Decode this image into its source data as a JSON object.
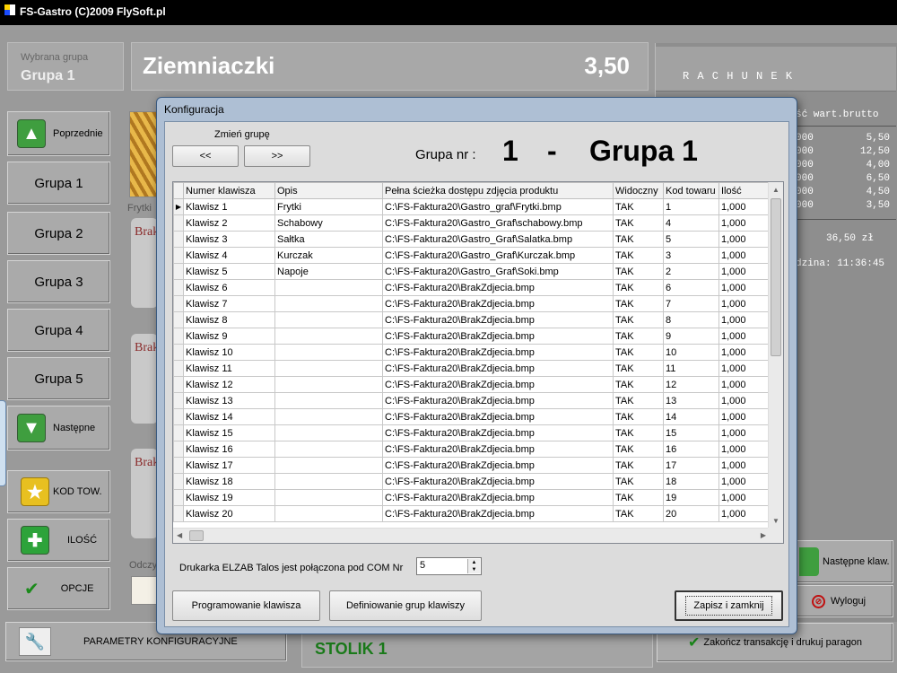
{
  "app": {
    "title": "FS-Gastro     (C)2009 FlySoft.pl"
  },
  "group_panel": {
    "label": "Wybrana grupa",
    "value": "Grupa 1"
  },
  "product_header": {
    "name": "Ziemniaczki",
    "price": "3,50"
  },
  "left_nav": {
    "prev_label": "Poprzednie",
    "groups": [
      "Grupa 1",
      "Grupa 2",
      "Grupa 3",
      "Grupa 4",
      "Grupa 5"
    ],
    "next_label": "Następne",
    "kod_label": "KOD TOW.",
    "ilosc_label": "ILOŚĆ",
    "opcje_label": "OPCJE",
    "params_label": "PARAMETRY  KONFIGURACYJNE"
  },
  "product_tiles": {
    "first_label": "Frytki",
    "placeholder_text": "Brak",
    "odczyt_label": "Odczy"
  },
  "table_label": "STOLIK 1",
  "receipt": {
    "heading": "R A C H U N E K",
    "col_header": "ść  wart.brutto",
    "rows": [
      {
        "qty": "000",
        "val": "5,50"
      },
      {
        "qty": "000",
        "val": "12,50"
      },
      {
        "qty": "000",
        "val": "4,00"
      },
      {
        "qty": "000",
        "val": "6,50"
      },
      {
        "qty": "000",
        "val": "4,50"
      },
      {
        "qty": "000",
        "val": "3,50"
      }
    ],
    "total": "36,50 zł",
    "time": "dzina: 11:36:45"
  },
  "right_buttons": {
    "next_keys": "Następne klaw.",
    "logout": "Wyloguj",
    "finish": "Zakończ transakcję i drukuj paragon"
  },
  "dialog": {
    "title": "Konfiguracja",
    "change_group_label": "Zmień grupę",
    "prev_btn": "<<",
    "next_btn": ">>",
    "group_nr_label": "Grupa nr :",
    "group_number": "1",
    "group_sep": "-",
    "group_name": "Grupa 1",
    "columns": [
      "Numer klawisza",
      "Opis",
      "Pełna ścieżka dostępu zdjęcia produktu",
      "Widoczny",
      "Kod towaru",
      "Ilość"
    ],
    "rows": [
      [
        "Klawisz 1",
        "Frytki",
        "C:\\FS-Faktura20\\Gastro_graf\\Frytki.bmp",
        "TAK",
        "1",
        "1,000"
      ],
      [
        "Klawisz 2",
        "Schabowy",
        "C:\\FS-Faktura20\\Gastro_Graf\\schabowy.bmp",
        "TAK",
        "4",
        "1,000"
      ],
      [
        "Klawisz 3",
        "Sałtka",
        "C:\\FS-Faktura20\\Gastro_Graf\\Salatka.bmp",
        "TAK",
        "5",
        "1,000"
      ],
      [
        "Klawisz 4",
        "Kurczak",
        "C:\\FS-Faktura20\\Gastro_Graf\\Kurczak.bmp",
        "TAK",
        "3",
        "1,000"
      ],
      [
        "Klawisz 5",
        "Napoje",
        "C:\\FS-Faktura20\\Gastro_Graf\\Soki.bmp",
        "TAK",
        "2",
        "1,000"
      ],
      [
        "Klawisz 6",
        "",
        "C:\\FS-Faktura20\\BrakZdjecia.bmp",
        "TAK",
        "6",
        "1,000"
      ],
      [
        "Klawisz 7",
        "",
        "C:\\FS-Faktura20\\BrakZdjecia.bmp",
        "TAK",
        "7",
        "1,000"
      ],
      [
        "Klawisz 8",
        "",
        "C:\\FS-Faktura20\\BrakZdjecia.bmp",
        "TAK",
        "8",
        "1,000"
      ],
      [
        "Klawisz 9",
        "",
        "C:\\FS-Faktura20\\BrakZdjecia.bmp",
        "TAK",
        "9",
        "1,000"
      ],
      [
        "Klawisz 10",
        "",
        "C:\\FS-Faktura20\\BrakZdjecia.bmp",
        "TAK",
        "10",
        "1,000"
      ],
      [
        "Klawisz 11",
        "",
        "C:\\FS-Faktura20\\BrakZdjecia.bmp",
        "TAK",
        "11",
        "1,000"
      ],
      [
        "Klawisz 12",
        "",
        "C:\\FS-Faktura20\\BrakZdjecia.bmp",
        "TAK",
        "12",
        "1,000"
      ],
      [
        "Klawisz 13",
        "",
        "C:\\FS-Faktura20\\BrakZdjecia.bmp",
        "TAK",
        "13",
        "1,000"
      ],
      [
        "Klawisz 14",
        "",
        "C:\\FS-Faktura20\\BrakZdjecia.bmp",
        "TAK",
        "14",
        "1,000"
      ],
      [
        "Klawisz 15",
        "",
        "C:\\FS-Faktura20\\BrakZdjecia.bmp",
        "TAK",
        "15",
        "1,000"
      ],
      [
        "Klawisz 16",
        "",
        "C:\\FS-Faktura20\\BrakZdjecia.bmp",
        "TAK",
        "16",
        "1,000"
      ],
      [
        "Klawisz 17",
        "",
        "C:\\FS-Faktura20\\BrakZdjecia.bmp",
        "TAK",
        "17",
        "1,000"
      ],
      [
        "Klawisz 18",
        "",
        "C:\\FS-Faktura20\\BrakZdjecia.bmp",
        "TAK",
        "18",
        "1,000"
      ],
      [
        "Klawisz 19",
        "",
        "C:\\FS-Faktura20\\BrakZdjecia.bmp",
        "TAK",
        "19",
        "1,000"
      ],
      [
        "Klawisz 20",
        "",
        "C:\\FS-Faktura20\\BrakZdjecia.bmp",
        "TAK",
        "20",
        "1,000"
      ]
    ],
    "printer_label": "Drukarka ELZAB Talos jest połączona pod COM Nr",
    "com_value": "5",
    "program_btn": "Programowanie klawisza",
    "define_btn": "Definiowanie grup klawiszy",
    "save_btn": "Zapisz i zamknij"
  },
  "colors": {
    "accent_green": "#2e8b2e",
    "table_label_green": "#1a7a1a",
    "dialog_frame": "#aebfd4"
  }
}
